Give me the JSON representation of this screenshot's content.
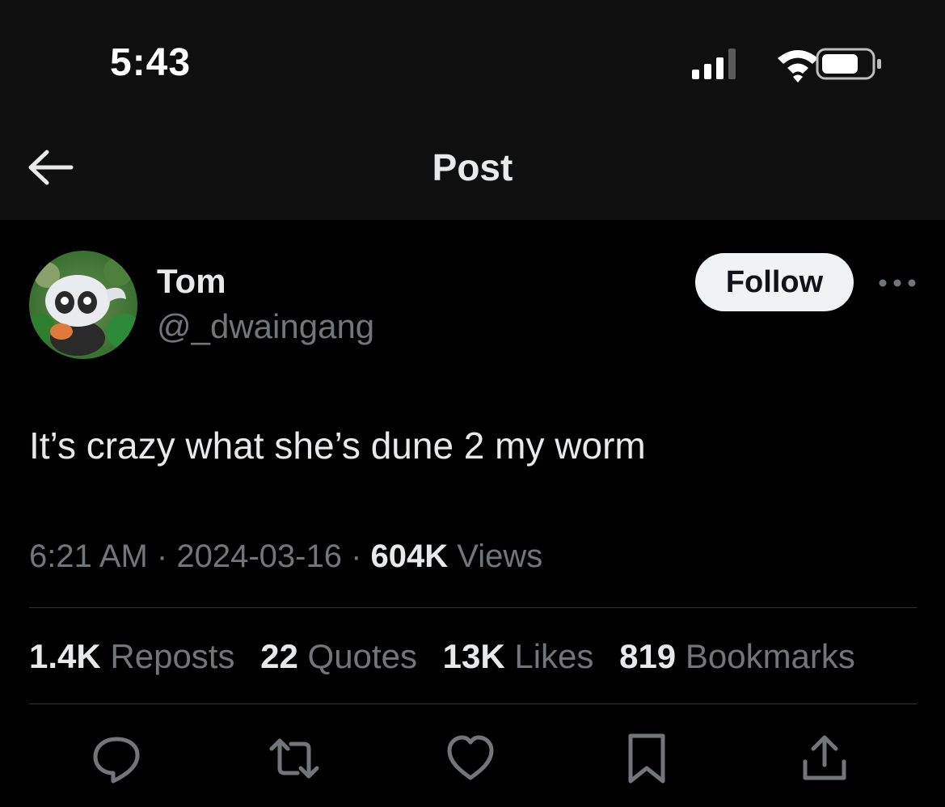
{
  "status_bar": {
    "time": "5:43",
    "icons": [
      "cellular-signal-icon",
      "wifi-icon",
      "battery-icon"
    ]
  },
  "nav": {
    "back_icon": "arrow-left-icon",
    "title": "Post"
  },
  "author": {
    "display_name": "Tom",
    "handle": "@_dwaingang",
    "follow_label": "Follow",
    "more_icon": "more-horizontal-icon"
  },
  "post": {
    "text": "It’s crazy what she’s dune 2 my worm",
    "time": "6:21 AM",
    "separator": "·",
    "date": "2024-03-16",
    "views_count": "604K",
    "views_label": "Views"
  },
  "stats": [
    {
      "count": "1.4K",
      "label": "Reposts"
    },
    {
      "count": "22",
      "label": "Quotes"
    },
    {
      "count": "13K",
      "label": "Likes"
    },
    {
      "count": "819",
      "label": "Bookmarks"
    }
  ],
  "actions": [
    "reply-icon",
    "repost-icon",
    "like-icon",
    "bookmark-icon",
    "share-icon"
  ],
  "colors": {
    "background": "#000000",
    "header_background": "#0f0f0f",
    "primary_text": "#e7e9ea",
    "secondary_text": "#71767b",
    "divider": "#2f3336",
    "follow_button": "#eff3f4"
  }
}
